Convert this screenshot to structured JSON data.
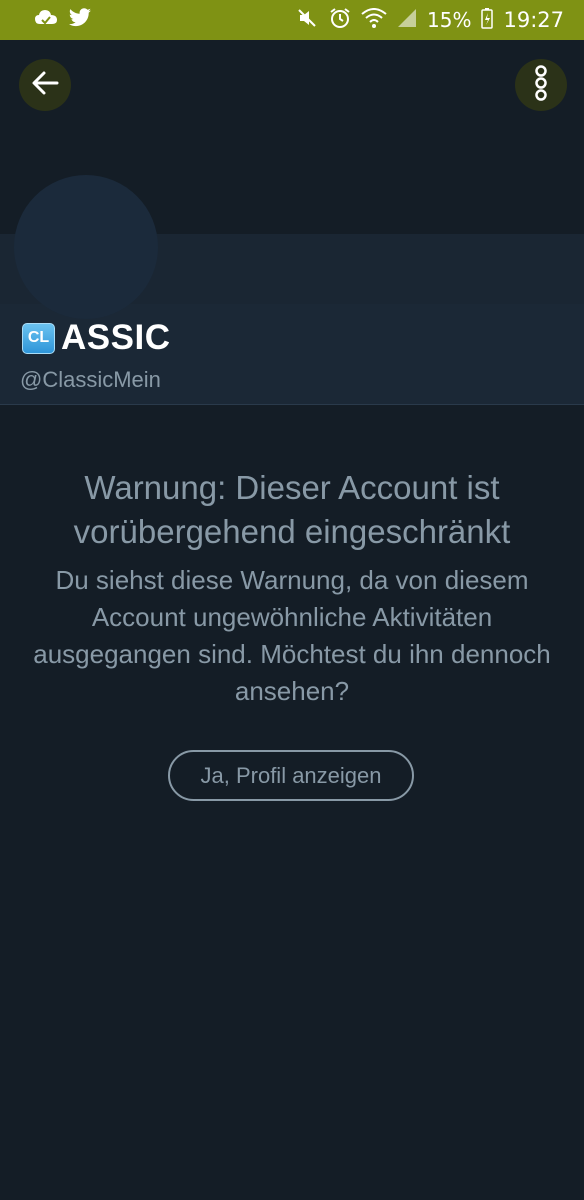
{
  "status_bar": {
    "battery": "15%",
    "time": "19:27",
    "icons_left": [
      "cloud-icon",
      "twitter-bird-icon"
    ],
    "icons_right": [
      "mute-icon",
      "alarm-icon",
      "wifi-icon",
      "signal-icon",
      "battery-charging-icon"
    ],
    "color": "#7f9214"
  },
  "app_bar": {
    "back_icon": "arrow-left-icon",
    "menu_icon": "vertical-dots-icon"
  },
  "profile": {
    "badge": "CL",
    "name": "ASSIC",
    "handle": "@ClassicMein"
  },
  "warning": {
    "title": "Warnung: Dieser Account ist vorübergehend eingeschränkt",
    "body": "Du siehst diese Warnung, da von diesem Account ungewöhnliche Aktivitäten ausgegangen sind. Möchtest du ihn dennoch ansehen?",
    "button": "Ja, Profil anzeigen"
  },
  "colors": {
    "background": "#141d26",
    "panel": "#1b2836",
    "muted_text": "#8899a6"
  }
}
